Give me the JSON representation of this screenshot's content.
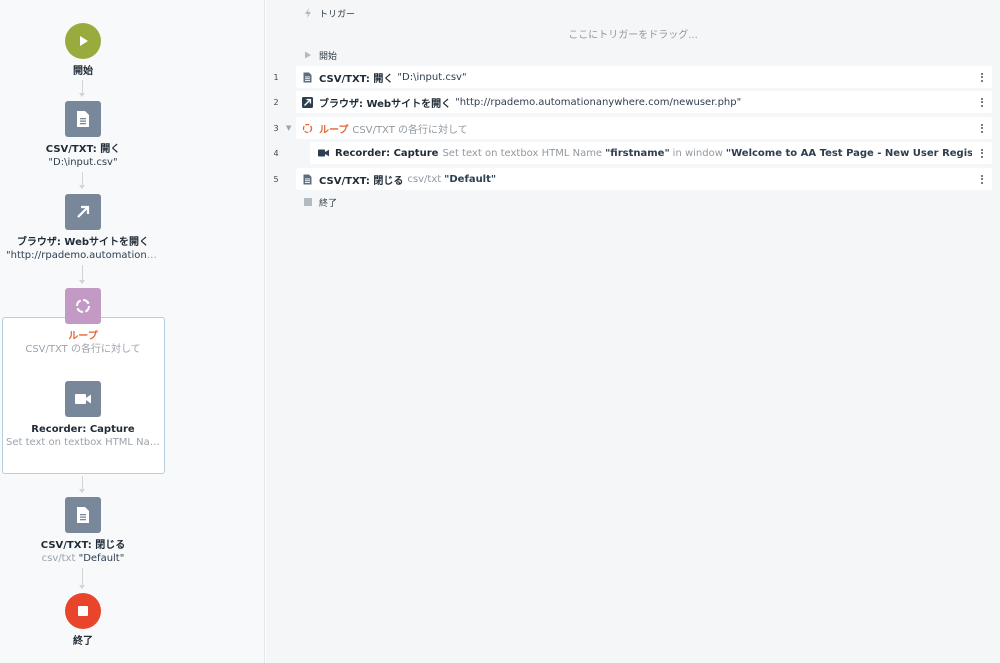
{
  "flow": {
    "start_label": "開始",
    "nodes": [
      {
        "title": "CSV/TXT: 開く",
        "sub": "\"D:\\input.csv\""
      },
      {
        "title": "ブラウザ: Webサイトを開く",
        "sub": "\"http://rpademo.automationa..."
      },
      {
        "title": "ループ",
        "sub": "CSV/TXT の各行に対して"
      },
      {
        "title": "Recorder: Capture",
        "sub": "Set text on textbox HTML Nam..."
      },
      {
        "title": "CSV/TXT: 閉じる",
        "sub_gray": "csv/txt",
        "sub_q": "\"Default\""
      }
    ],
    "end_label": "終了"
  },
  "list": {
    "trigger_label": "トリガー",
    "trigger_drop": "ここにトリガーをドラッグ...",
    "start_label": "開始",
    "rows": [
      {
        "num": "1",
        "title": "CSV/TXT: 開く",
        "q": "\"D:\\input.csv\""
      },
      {
        "num": "2",
        "title": "ブラウザ: Webサイトを開く",
        "q": "\"http://rpademo.automationanywhere.com/newuser.php\""
      },
      {
        "num": "3",
        "title": "ループ",
        "gray": "CSV/TXT の各行に対して"
      },
      {
        "num": "4",
        "title": "Recorder: Capture",
        "gray1": "Set text on textbox HTML Name",
        "qb1": "\"firstname\"",
        "gray2": "in window",
        "qb2": "\"Welcome to AA Test Page - New User Registration - Google Chrome\""
      },
      {
        "num": "5",
        "title": "CSV/TXT: 閉じる",
        "gray": "csv/txt",
        "qb": "\"Default\""
      }
    ],
    "end_label": "終了"
  },
  "colors": {
    "start": "#9aab3e",
    "action": "#78889a",
    "loop": "#c39ac6",
    "end": "#e8452c",
    "loop_accent": "#e2673a"
  }
}
